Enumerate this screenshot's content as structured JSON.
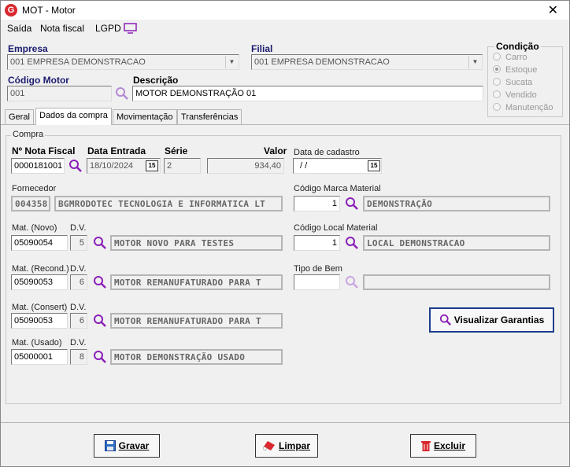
{
  "window": {
    "icon_letter": "G",
    "title": "MOT - Motor",
    "close": "✕"
  },
  "menu": {
    "items": [
      "Saída",
      "Nota fiscal",
      "LGPD"
    ]
  },
  "header": {
    "empresa_label": "Empresa",
    "empresa_value": "001 EMPRESA DEMONSTRACAO",
    "filial_label": "Filial",
    "filial_value": "001 EMPRESA DEMONSTRACAO",
    "codigo_label": "Código Motor",
    "codigo_value": "001",
    "descricao_label": "Descrição",
    "descricao_value": "MOTOR DEMONSTRAÇÃO 01"
  },
  "condicao": {
    "label": "Condição",
    "options": [
      "Carro",
      "Estoque",
      "Sucata",
      "Vendido",
      "Manutenção"
    ],
    "selected": "Estoque"
  },
  "tabs": [
    "Geral",
    "Dados da compra",
    "Movimentação",
    "Transferências"
  ],
  "compra": {
    "group_label": "Compra",
    "nf_label": "Nº Nota Fiscal",
    "nf_value": "0000181001",
    "data_entrada_label": "Data Entrada",
    "data_entrada_value": "18/10/2024",
    "serie_label": "Série",
    "serie_value": "2",
    "valor_label": "Valor",
    "valor_value": "934,40",
    "data_cadastro_label": "Data de cadastro",
    "data_cadastro_value": " / /",
    "fornecedor_label": "Fornecedor",
    "fornecedor_code": "004358",
    "fornecedor_name": "BGMRODOTEC TECNOLOGIA E INFORMATICA LT",
    "marca_label": "Código Marca Material",
    "marca_code": "1",
    "marca_name": "DEMONSTRAÇÃO",
    "local_label": "Código Local Material",
    "local_code": "1",
    "local_name": "LOCAL DEMONSTRACAO",
    "tipo_bem_label": "Tipo de Bem",
    "tipo_bem_code": "",
    "tipo_bem_name": "",
    "dv_label": "D.V.",
    "mat_novo_label": "Mat. (Novo)",
    "mat_novo_code": "05090054",
    "mat_novo_dv": "5",
    "mat_novo_name": "MOTOR NOVO PARA TESTES",
    "mat_recond_label": "Mat. (Recond.)",
    "mat_recond_code": "05090053",
    "mat_recond_dv": "6",
    "mat_recond_name": "MOTOR REMANUFATURADO PARA T",
    "mat_consert_label": "Mat. (Consert)",
    "mat_consert_code": "05090053",
    "mat_consert_dv": "6",
    "mat_consert_name": "MOTOR REMANUFATURADO PARA T",
    "mat_usado_label": "Mat. (Usado)",
    "mat_usado_code": "05000001",
    "mat_usado_dv": "8",
    "mat_usado_name": "MOTOR DEMONSTRAÇÃO USADO",
    "garantias_button": "Visualizar Garantias"
  },
  "footer": {
    "gravar": "Gravar",
    "limpar": "Limpar",
    "excluir": "Excluir"
  },
  "colors": {
    "label_blue": "#1a1a6e",
    "magnifier": "#8b1fb8",
    "brand_red": "#d9282f"
  }
}
